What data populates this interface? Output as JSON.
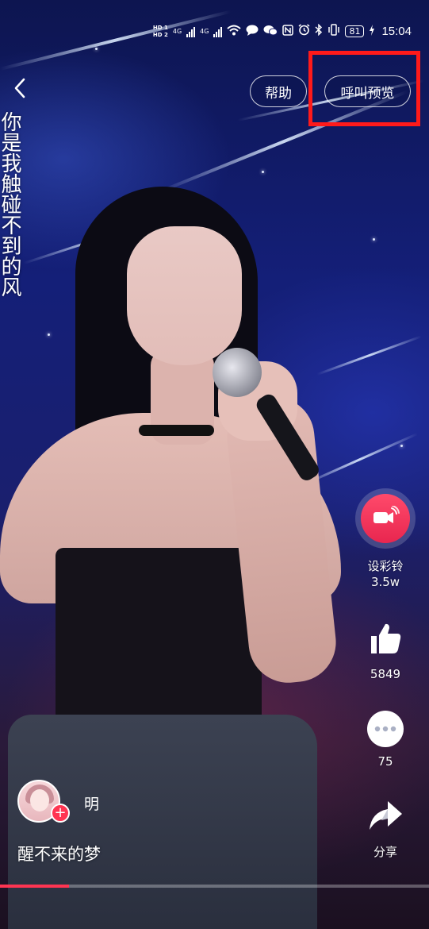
{
  "status_bar": {
    "hd1": "HD 1",
    "hd2": "HD 2",
    "net1": "4G",
    "net2": "4G",
    "battery": "81",
    "time": "15:04",
    "icons": [
      "hd-icon",
      "signal-icon",
      "wifi-icon",
      "message-icon",
      "wechat-icon",
      "nfc-icon",
      "alarm-icon",
      "bluetooth-icon",
      "vibrate-icon",
      "battery-icon",
      "charging-icon"
    ]
  },
  "nav": {
    "back_icon": "chevron-left-icon",
    "help_label": "帮助",
    "preview_label": "呼叫预览"
  },
  "lyric": {
    "text": "你是我触碰不到的风"
  },
  "actions": {
    "ringtone": {
      "icon": "video-ringtone-icon",
      "label": "设彩铃",
      "count": "3.5w"
    },
    "like": {
      "icon": "thumbs-up-icon",
      "count": "5849"
    },
    "comment": {
      "icon": "comment-bubble-icon",
      "count": "75"
    },
    "share": {
      "icon": "share-arrow-icon",
      "label": "分享"
    }
  },
  "author": {
    "name": "明",
    "follow_icon": "plus-icon"
  },
  "video": {
    "title": "醒不来的梦",
    "progress": 0.16
  },
  "colors": {
    "accent": "#ff3552",
    "highlight_box": "#ff1a1a"
  }
}
